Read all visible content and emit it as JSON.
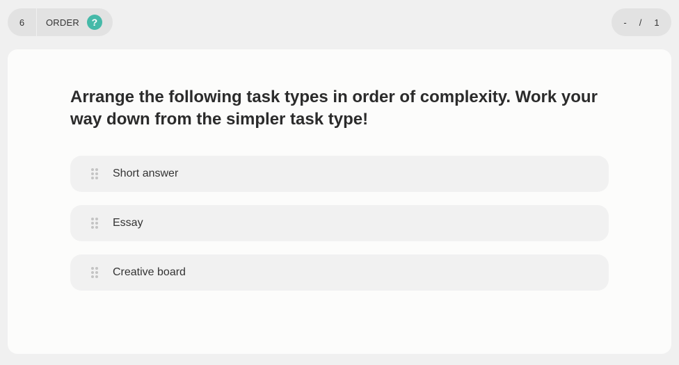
{
  "header": {
    "question_number": "6",
    "question_type": "ORDER",
    "help_symbol": "?",
    "progress": {
      "current": "-",
      "separator": "/",
      "total": "1"
    }
  },
  "question": {
    "text": "Arrange the following task types in order of complexity. Work your way down from the simpler task type!"
  },
  "options": [
    {
      "label": "Short answer",
      "icon": "drag-handle-icon"
    },
    {
      "label": "Essay",
      "icon": "drag-handle-icon"
    },
    {
      "label": "Creative board",
      "icon": "drag-handle-icon"
    }
  ],
  "colors": {
    "accent": "#45b9a8",
    "background": "#f0f0f0",
    "card": "#fcfcfb",
    "option": "#f1f1f1"
  }
}
